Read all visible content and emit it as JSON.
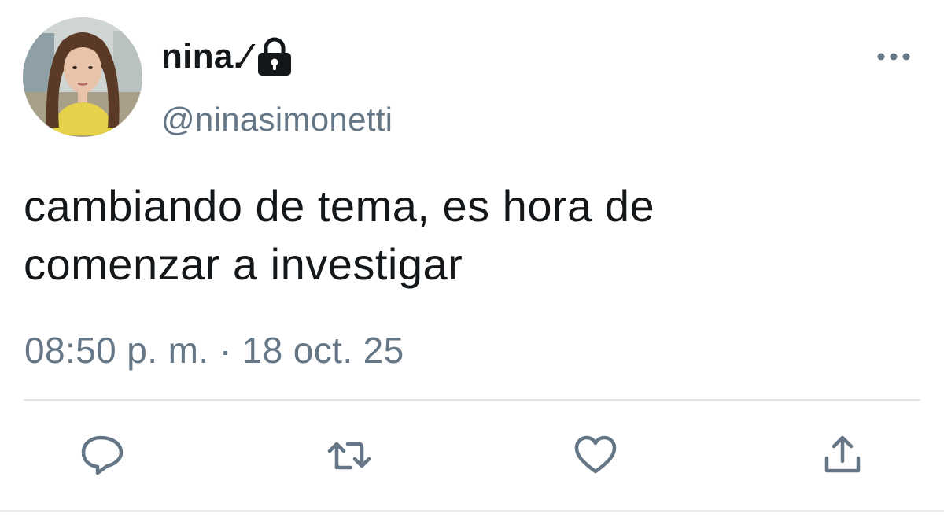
{
  "tweet": {
    "display_name": "nina.⁄",
    "handle": "@ninasimonetti",
    "protected_icon": "lock-icon",
    "text_lines": [
      "cambiando de tema, es hora de",
      "comenzar a investigar"
    ],
    "timestamp": "08:50 p. m. · 18 oct. 25"
  },
  "actions": {
    "reply_icon": "speech-bubble-icon",
    "retweet_icon": "retweet-arrows-icon",
    "like_icon": "heart-icon",
    "share_icon": "share-upload-icon",
    "more_icon": "ellipsis-icon"
  },
  "colors": {
    "text_primary": "#14171a",
    "text_secondary": "#657786",
    "divider": "#e1e8ed"
  }
}
